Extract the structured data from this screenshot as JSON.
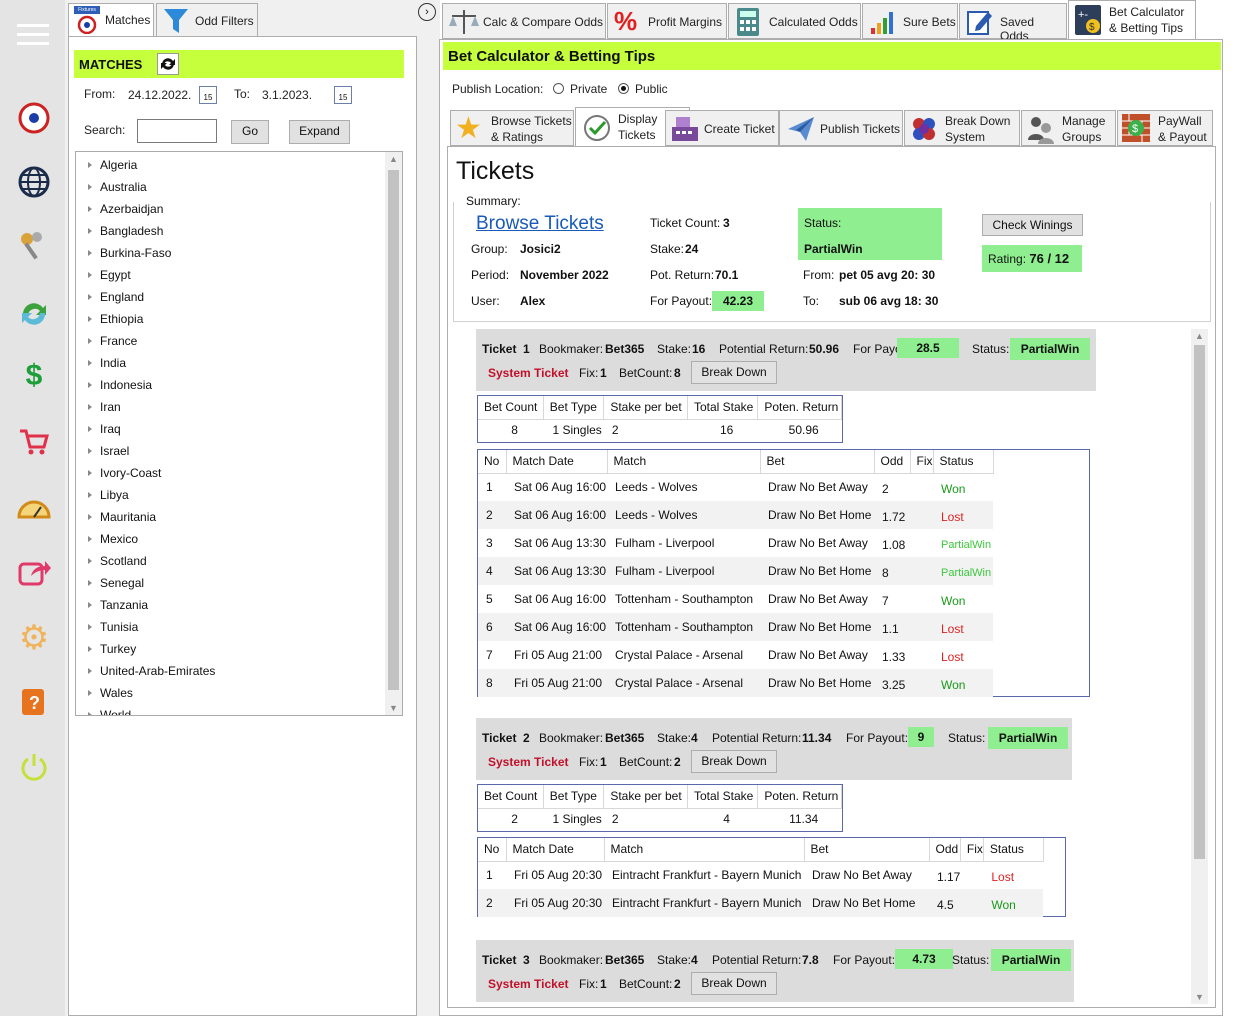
{
  "rail_icons": [
    "menu-icon",
    "soccer-ball-icon",
    "globe-icon",
    "keys-icon",
    "refresh-icon",
    "dollar-icon",
    "cart-icon",
    "gauge-icon",
    "share-icon",
    "gear-icon",
    "help-book-icon",
    "power-icon"
  ],
  "left_tabs": {
    "matches": "Matches",
    "odd_filters": "Odd Filters",
    "fixtures_badge": "Fixtures"
  },
  "matches": {
    "header": "MATCHES",
    "from_label": "From:",
    "from_value": "24.12.2022.",
    "to_label": "To:",
    "to_value": "3.1.2023.",
    "cal_day": "15",
    "search_label": "Search:",
    "search_value": "",
    "go": "Go",
    "expand": "Expand",
    "countries": [
      "Algeria",
      "Australia",
      "Azerbaidjan",
      "Bangladesh",
      "Burkina-Faso",
      "Egypt",
      "England",
      "Ethiopia",
      "France",
      "India",
      "Indonesia",
      "Iran",
      "Iraq",
      "Israel",
      "Ivory-Coast",
      "Libya",
      "Mauritania",
      "Mexico",
      "Scotland",
      "Senegal",
      "Tanzania",
      "Tunisia",
      "Turkey",
      "United-Arab-Emirates",
      "Wales",
      "World"
    ]
  },
  "top_tabs": [
    "Calc & Compare Odds",
    "Profit Margins",
    "Calculated Odds",
    "Sure Bets",
    "Saved Odds"
  ],
  "active_tab": {
    "line1": "Bet Calculator",
    "line2": "& Betting Tips"
  },
  "panel_title": "Bet Calculator & Betting Tips",
  "publish": {
    "label": "Publish Location:",
    "private": "Private",
    "public": "Public",
    "selected": "Public"
  },
  "sub_tabs": {
    "browse": [
      "Browse Tickets",
      "& Ratings"
    ],
    "display": [
      "Display",
      "Tickets"
    ],
    "create": "Create Ticket",
    "publish": "Publish Tickets",
    "breakdown": [
      "Break Down",
      "System"
    ],
    "manage": [
      "Manage",
      "Groups"
    ],
    "paywall": [
      "PayWall",
      "& Payout"
    ]
  },
  "tickets_title": "Tickets",
  "summary": {
    "label": "Summary:",
    "browse_link": "Browse Tickets",
    "group_label": "Group:",
    "group": "Josici2",
    "period_label": "Period:",
    "period": "November 2022",
    "user_label": "User:",
    "user": "Alex",
    "count_label": "Ticket Count:",
    "count": "3",
    "stake_label": "Stake:",
    "stake": "24",
    "pot_label": "Pot. Return:",
    "pot": "70.1",
    "payout_label": "For Payout:",
    "payout": "42.23",
    "status_label": "Status:",
    "status": "PartialWin",
    "from_label": "From:",
    "from": "pet 05 avg 20: 30",
    "to_label": "To:",
    "to": "sub 06 avg 18: 30",
    "check": "Check Winings",
    "rating_label": "Rating:",
    "rating": "76 / 12"
  },
  "labels": {
    "ticket": "Ticket",
    "bookmaker": "Bookmaker:",
    "stake": "Stake:",
    "potential": "Potential Return:",
    "for_payout": "For Payout:",
    "status": "Status:",
    "system": "System Ticket",
    "fix": "Fix:",
    "betcount": "BetCount:",
    "breakdown": "Break Down",
    "bet_cols": [
      "Bet Count",
      "Bet Type",
      "Stake per bet",
      "Total Stake",
      "Poten. Return"
    ],
    "match_cols": [
      "No",
      "Match Date",
      "Match",
      "Bet",
      "Odd",
      "Fix",
      "Status"
    ]
  },
  "tickets": [
    {
      "no": "1",
      "bookmaker": "Bet365",
      "stake": "16",
      "potential": "50.96",
      "payout": "28.5",
      "status": "PartialWin",
      "fix": "1",
      "betcount": "8",
      "summary_row": [
        "8",
        "1 Singles",
        "2",
        "16",
        "50.96"
      ],
      "matches": [
        [
          "1",
          "Sat 06 Aug 16:00",
          "Leeds - Wolves",
          "Draw No Bet Away",
          "2",
          "",
          "Won"
        ],
        [
          "2",
          "Sat 06 Aug 16:00",
          "Leeds - Wolves",
          "Draw No Bet Home",
          "1.72",
          "",
          "Lost"
        ],
        [
          "3",
          "Sat 06 Aug 13:30",
          "Fulham - Liverpool",
          "Draw No Bet Away",
          "1.08",
          "",
          "PartialWin"
        ],
        [
          "4",
          "Sat 06 Aug 13:30",
          "Fulham - Liverpool",
          "Draw No Bet Home",
          "8",
          "",
          "PartialWin"
        ],
        [
          "5",
          "Sat 06 Aug 16:00",
          "Tottenham - Southampton",
          "Draw No Bet Away",
          "7",
          "",
          "Won"
        ],
        [
          "6",
          "Sat 06 Aug 16:00",
          "Tottenham - Southampton",
          "Draw No Bet Home",
          "1.1",
          "",
          "Lost"
        ],
        [
          "7",
          "Fri 05 Aug 21:00",
          "Crystal Palace - Arsenal",
          "Draw No Bet Away",
          "1.33",
          "",
          "Lost"
        ],
        [
          "8",
          "Fri 05 Aug 21:00",
          "Crystal Palace - Arsenal",
          "Draw No Bet Home",
          "3.25",
          "",
          "Won"
        ]
      ]
    },
    {
      "no": "2",
      "bookmaker": "Bet365",
      "stake": "4",
      "potential": "11.34",
      "payout": "9",
      "status": "PartialWin",
      "fix": "1",
      "betcount": "2",
      "summary_row": [
        "2",
        "1 Singles",
        "2",
        "4",
        "11.34"
      ],
      "matches": [
        [
          "1",
          "Fri 05 Aug 20:30",
          "Eintracht Frankfurt - Bayern Munich",
          "Draw No Bet Away",
          "1.17",
          "",
          "Lost"
        ],
        [
          "2",
          "Fri 05 Aug 20:30",
          "Eintracht Frankfurt - Bayern Munich",
          "Draw No Bet Home",
          "4.5",
          "",
          "Won"
        ]
      ]
    },
    {
      "no": "3",
      "bookmaker": "Bet365",
      "stake": "4",
      "potential": "7.8",
      "payout": "4.73",
      "status": "PartialWin",
      "fix": "1",
      "betcount": "2"
    }
  ]
}
